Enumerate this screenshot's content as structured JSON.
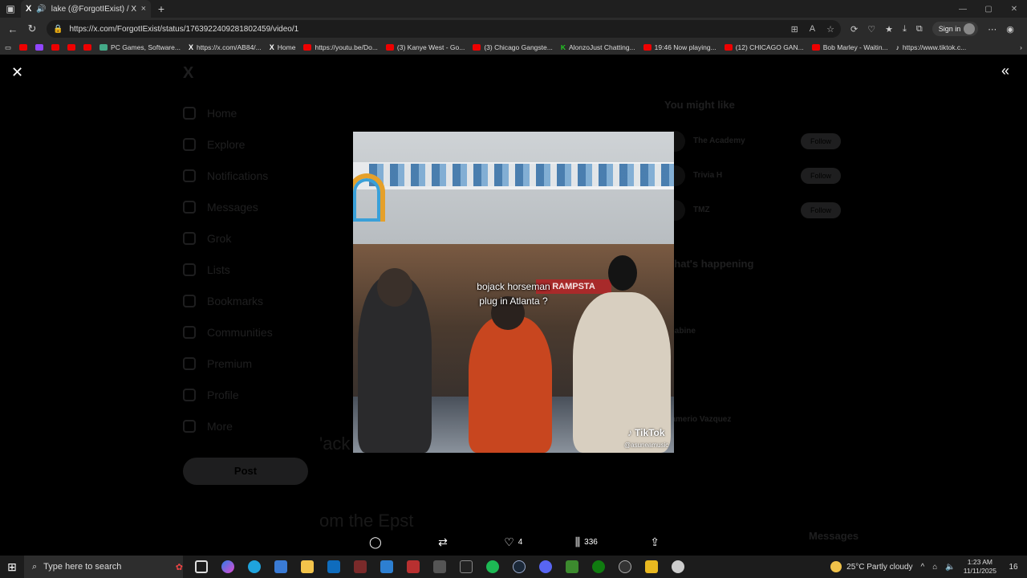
{
  "browser": {
    "tab": {
      "favicon": "X",
      "title": "lake (@ForgotIExist) / X",
      "close": "×"
    },
    "new_tab": "+",
    "window_controls": [
      "—",
      "▢",
      "✕"
    ],
    "url": "https://x.com/ForgotIExist/status/1763922409281802459/video/1",
    "sign_in": "Sign in",
    "bookmarks": [
      {
        "icon": "youtube-icon",
        "label": ""
      },
      {
        "icon": "twitch-icon",
        "label": ""
      },
      {
        "icon": "youtube-icon",
        "label": ""
      },
      {
        "icon": "youtube-icon",
        "label": ""
      },
      {
        "icon": "youtube-icon",
        "label": ""
      },
      {
        "icon": "pc-games-icon",
        "label": "PC Games, Software..."
      },
      {
        "icon": "x-icon",
        "label": "https://x.com/AB84/..."
      },
      {
        "icon": "x-icon",
        "label": "Home"
      },
      {
        "icon": "youtube-icon",
        "label": "https://youtu.be/Do..."
      },
      {
        "icon": "youtube-icon",
        "label": "(3) Kanye West - Go..."
      },
      {
        "icon": "youtube-icon",
        "label": "(3) Chicago Gangste..."
      },
      {
        "icon": "alonzo-icon",
        "label": "AlonzoJust Chatting..."
      },
      {
        "icon": "youtube-icon",
        "label": "19:46 Now playing..."
      },
      {
        "icon": "youtube-icon",
        "label": "(12) CHICAGO GAN..."
      },
      {
        "icon": "youtube-icon",
        "label": "Bob Marley - Waitin..."
      },
      {
        "icon": "tiktok-icon",
        "label": "https://www.tiktok.c..."
      }
    ]
  },
  "background": {
    "nav": [
      "Home",
      "Explore",
      "Notifications",
      "Messages",
      "Grok",
      "Lists",
      "Bookmarks",
      "Communities",
      "Premium",
      "Profile",
      "More"
    ],
    "post_button": "Post",
    "you_might_like": "You might like",
    "suggestions": [
      {
        "name": "The Academy",
        "follow": "Follow"
      },
      {
        "name": "Trivia H",
        "follow": "Follow"
      },
      {
        "name": "TMZ",
        "follow": "Follow"
      }
    ],
    "whats_happening": "What's happening",
    "trends": [
      "...",
      "Shabine",
      "...",
      "...amerio Vazquez"
    ],
    "center_text_1": "'ack",
    "center_text_2": "om the Epst",
    "messages": "Messages"
  },
  "video": {
    "caption_line1": "bojack horseman",
    "caption_line2": "plug in Atlanta ?",
    "watermark": "TikTok",
    "handle": "@asuneamusic",
    "store_sign": "RAMPSTA"
  },
  "actions": {
    "reply_count": "",
    "repost_count": "",
    "like_count": "4",
    "views_count": "336"
  },
  "taskbar": {
    "search_placeholder": "Type here to search",
    "weather": "25°C  Partly cloudy",
    "time": "1:23 AM",
    "date": "11/11/2025",
    "notifications": "16"
  }
}
